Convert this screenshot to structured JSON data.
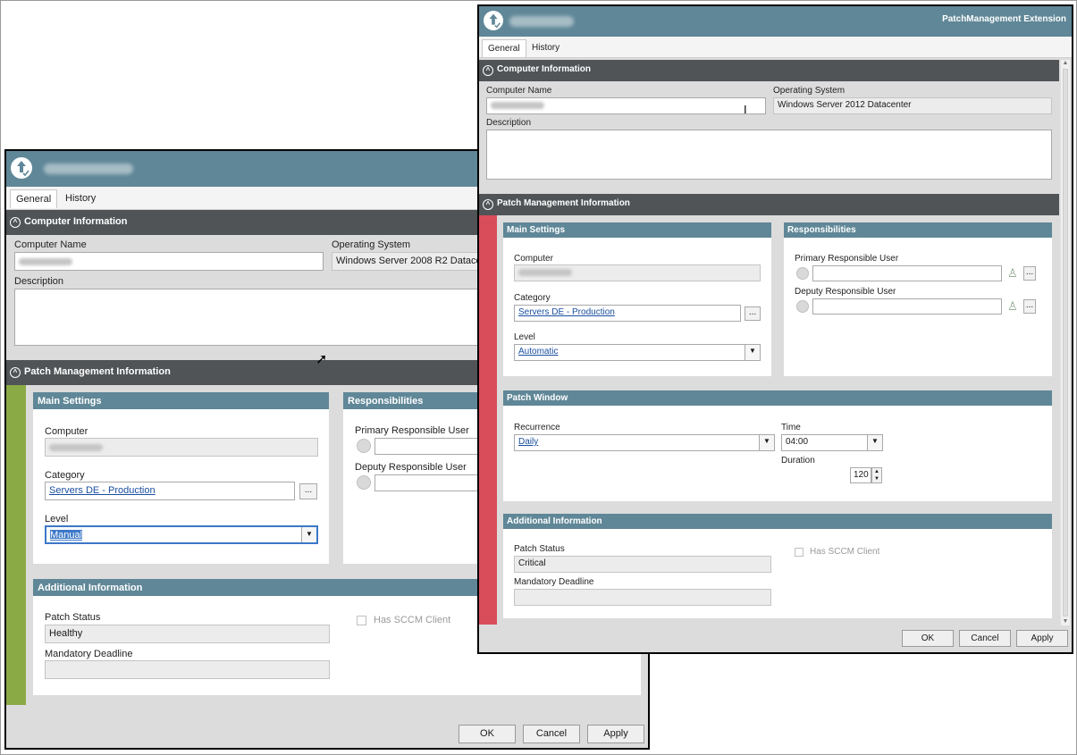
{
  "left_window": {
    "tabs": [
      "General",
      "History"
    ],
    "computer_section": {
      "title": "Computer Information",
      "computer_name_label": "Computer Name",
      "os_label": "Operating System",
      "os_value": "Windows Server 2008 R2 Datacenter",
      "description_label": "Description"
    },
    "patch_section": {
      "title": "Patch Management Information"
    },
    "main_settings": {
      "title": "Main Settings",
      "computer_label": "Computer",
      "category_label": "Category",
      "category_value": "Servers DE - Production",
      "level_label": "Level",
      "level_value": "Manual"
    },
    "responsibilities": {
      "title": "Responsibilities",
      "primary_label": "Primary Responsible User",
      "deputy_label": "Deputy Responsible User"
    },
    "additional": {
      "title": "Additional Information",
      "patch_status_label": "Patch Status",
      "patch_status_value": "Healthy",
      "deadline_label": "Mandatory Deadline",
      "sccm_label": "Has SCCM Client"
    },
    "buttons": {
      "ok": "OK",
      "cancel": "Cancel",
      "apply": "Apply"
    },
    "accent_color": "#8aaa45"
  },
  "right_window": {
    "extension_title": "PatchManagement Extension",
    "tabs": [
      "General",
      "History"
    ],
    "computer_section": {
      "title": "Computer Information",
      "computer_name_label": "Computer Name",
      "os_label": "Operating System",
      "os_value": "Windows Server 2012 Datacenter",
      "description_label": "Description"
    },
    "patch_section": {
      "title": "Patch Management Information"
    },
    "main_settings": {
      "title": "Main Settings",
      "computer_label": "Computer",
      "category_label": "Category",
      "category_value": "Servers DE - Production",
      "level_label": "Level",
      "level_value": "Automatic"
    },
    "responsibilities": {
      "title": "Responsibilities",
      "primary_label": "Primary Responsible User",
      "deputy_label": "Deputy Responsible User"
    },
    "patch_window": {
      "title": "Patch Window",
      "recurrence_label": "Recurrence",
      "recurrence_value": "Daily",
      "time_label": "Time",
      "time_value": "04:00",
      "duration_label": "Duration",
      "duration_value": "120"
    },
    "additional": {
      "title": "Additional Information",
      "patch_status_label": "Patch Status",
      "patch_status_value": "Critical",
      "deadline_label": "Mandatory Deadline",
      "sccm_label": "Has SCCM Client"
    },
    "buttons": {
      "ok": "OK",
      "cancel": "Cancel",
      "apply": "Apply"
    },
    "accent_color": "#d94d5b"
  },
  "icons": {
    "app_logo": "upload-check-icon",
    "collapse": "chevron-up-icon",
    "dropdown": "chevron-down-icon",
    "browse": "ellipsis-icon",
    "user_pick": "person-icon"
  }
}
